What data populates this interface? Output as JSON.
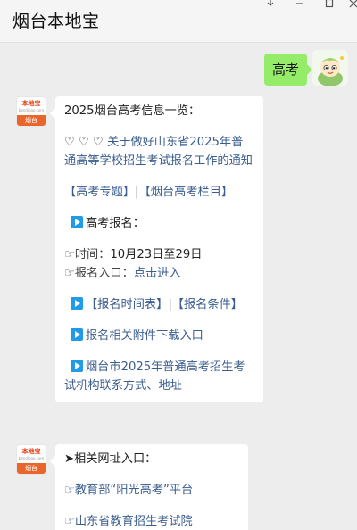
{
  "window": {
    "title": "烟台本地宝",
    "controls": [
      "pin",
      "minimize",
      "maximize",
      "close"
    ]
  },
  "chat": {
    "outgoing": {
      "text": "高考",
      "bubble_color": "#95ec69"
    },
    "bot_avatar": {
      "brand": "本地宝",
      "url": "bendibao.com",
      "city": "烟台"
    },
    "message1": {
      "heading": "2025烟台高考信息一览：",
      "hearts": "♡ ♡ ♡",
      "notice_link": "关于做好山东省2025年普通高等学校招生考试报名工作的通知",
      "topic_link1": "【高考专题】",
      "separator": "|",
      "topic_link2": "【烟台高考栏目】",
      "section_registration": "高考报名：",
      "time_label": "☞时间：",
      "time_value": "10月23日至29日",
      "entry_label": "☞报名入口：",
      "entry_link": "点击进入",
      "schedule_link": "【报名时间表】",
      "conditions_link": "【报名条件】",
      "attachments_link": "报名相关附件下载入口",
      "contact_link": "烟台市2025年普通高考招生考试机构联系方式、地址"
    },
    "message2": {
      "heading": "➤相关网址入口：",
      "site1_link": "☞教育部“阳光高考”平台",
      "site2_link": "☞山东省教育招生考试院"
    },
    "link_color": "#3b5d8f",
    "play_icon_color": "#1f9bea"
  }
}
